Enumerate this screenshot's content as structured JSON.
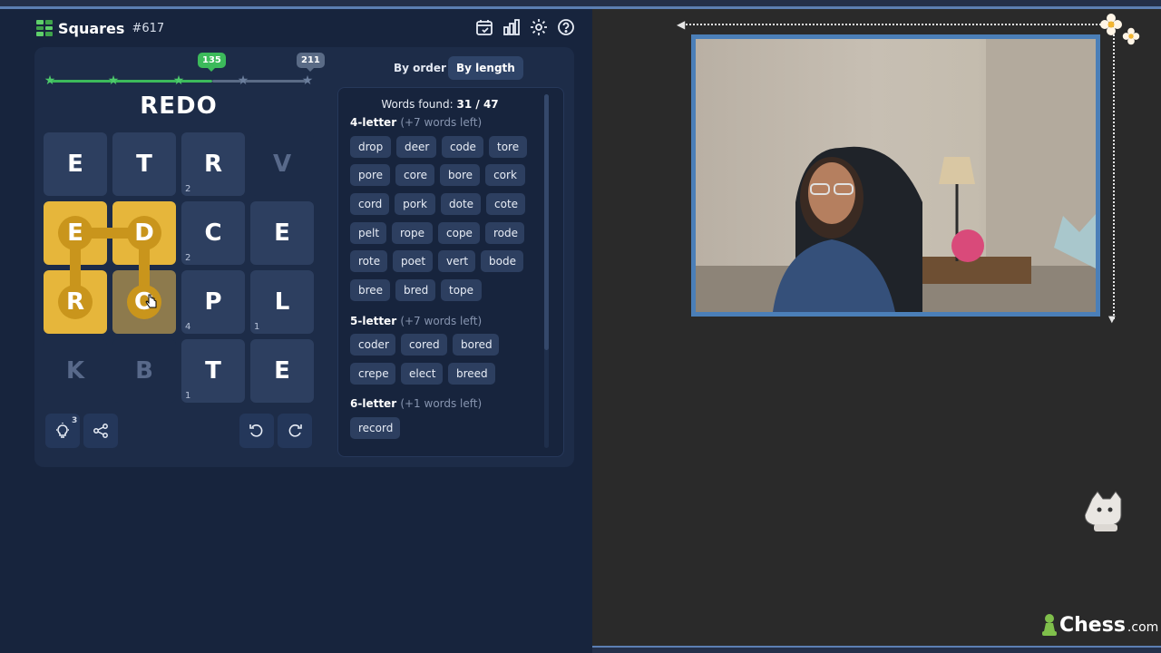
{
  "app": {
    "name": "Squares",
    "puzzle_number": "#617"
  },
  "header_icons": [
    "calendar-icon",
    "stats-icon",
    "gear-icon",
    "help-icon"
  ],
  "progress": {
    "badge_current": "135",
    "badge_max": "211"
  },
  "current_word": "REDO",
  "grid": {
    "tiles": [
      {
        "letter": "E",
        "count": "",
        "state": "normal"
      },
      {
        "letter": "T",
        "count": "",
        "state": "normal"
      },
      {
        "letter": "R",
        "count": "2",
        "state": "normal"
      },
      {
        "letter": "V",
        "count": "",
        "state": "inactive"
      },
      {
        "letter": "E",
        "count": "",
        "state": "selected"
      },
      {
        "letter": "D",
        "count": "",
        "state": "selected"
      },
      {
        "letter": "C",
        "count": "2",
        "state": "normal"
      },
      {
        "letter": "E",
        "count": "",
        "state": "normal"
      },
      {
        "letter": "R",
        "count": "",
        "state": "selected"
      },
      {
        "letter": "O",
        "count": "",
        "state": "current"
      },
      {
        "letter": "P",
        "count": "4",
        "state": "normal"
      },
      {
        "letter": "L",
        "count": "1",
        "state": "normal"
      },
      {
        "letter": "K",
        "count": "",
        "state": "inactive"
      },
      {
        "letter": "B",
        "count": "",
        "state": "inactive"
      },
      {
        "letter": "T",
        "count": "1",
        "state": "normal"
      },
      {
        "letter": "E",
        "count": "",
        "state": "normal"
      }
    ]
  },
  "controls": {
    "hint_count": "3",
    "buttons": [
      "hint-icon",
      "share-icon",
      "rotate-left-icon",
      "rotate-right-icon"
    ]
  },
  "sort": {
    "by_order": "By order",
    "by_length": "By length"
  },
  "words_found": {
    "label": "Words found:",
    "value": "31 / 47"
  },
  "sections": [
    {
      "title": "4-letter",
      "remaining": "(+7 words left)",
      "words": [
        "drop",
        "deer",
        "code",
        "tore",
        "pore",
        "core",
        "bore",
        "cork",
        "cord",
        "pork",
        "dote",
        "cote",
        "pelt",
        "rope",
        "cope",
        "rode",
        "rote",
        "poet",
        "vert",
        "bode",
        "bree",
        "bred",
        "tope"
      ]
    },
    {
      "title": "5-letter",
      "remaining": "(+7 words left)",
      "words": [
        "coder",
        "cored",
        "bored",
        "crepe",
        "elect",
        "breed"
      ]
    },
    {
      "title": "6-letter",
      "remaining": "(+1 words left)",
      "words": [
        "record"
      ]
    }
  ],
  "watermark": {
    "brand": "Chess",
    "domain": ".com"
  },
  "colors": {
    "background_game": "#17243d",
    "tile": "#2d3f60",
    "selected": "#e6b63b",
    "path": "#c9951c",
    "progress_green": "#3cba5b"
  }
}
